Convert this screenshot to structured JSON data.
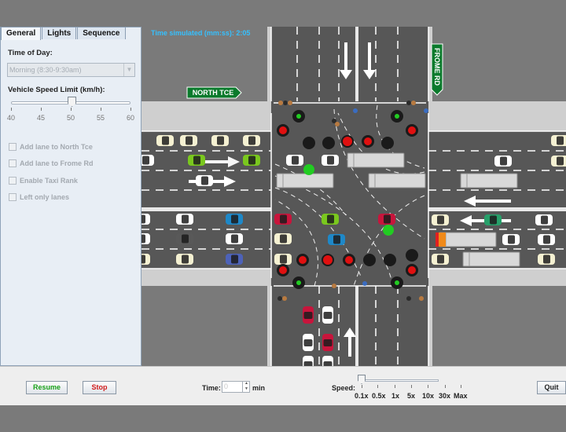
{
  "tabs": [
    {
      "label": "General",
      "active": true
    },
    {
      "label": "Lights",
      "active": false
    },
    {
      "label": "Sequence",
      "active": false
    }
  ],
  "panel": {
    "time_of_day_label": "Time of Day:",
    "time_of_day_value": "Morning (8:30-9:30am)",
    "speed_limit_label": "Vehicle Speed Limit (km/h):",
    "speed_ticks": [
      "40",
      "45",
      "50",
      "55",
      "60"
    ],
    "speed_value": 50,
    "checkboxes": [
      {
        "label": "Add lane to North Tce",
        "checked": false
      },
      {
        "label": "Add lane to Frome Rd",
        "checked": false
      },
      {
        "label": "Enable Taxi Rank",
        "checked": false
      },
      {
        "label": "Left only lanes",
        "checked": false
      }
    ]
  },
  "map": {
    "time_simulated": "Time simulated (mm:ss): 2:05",
    "sign_north_tce": "NORTH TCE",
    "sign_frome_rd": "FROME RD"
  },
  "controls": {
    "resume_label": "Resume",
    "stop_label": "Stop",
    "time_label": "Time:",
    "time_value": "0",
    "min_label": "min",
    "speed_label": "Speed:",
    "speed_ticks": [
      "0.1x",
      "0.5x",
      "1x",
      "5x",
      "10x",
      "30x",
      "Max"
    ],
    "speed_selected": "0.1x",
    "quit_label": "Quit"
  },
  "colors": {
    "road": "#575757",
    "pavement": "#d3d3d3",
    "sign_green": "#0b7a2c",
    "light_red": "#e01010",
    "light_green": "#22cc22",
    "resume_text": "#1aa21a",
    "stop_text": "#d11a1a",
    "time_text": "#35c0ff"
  }
}
